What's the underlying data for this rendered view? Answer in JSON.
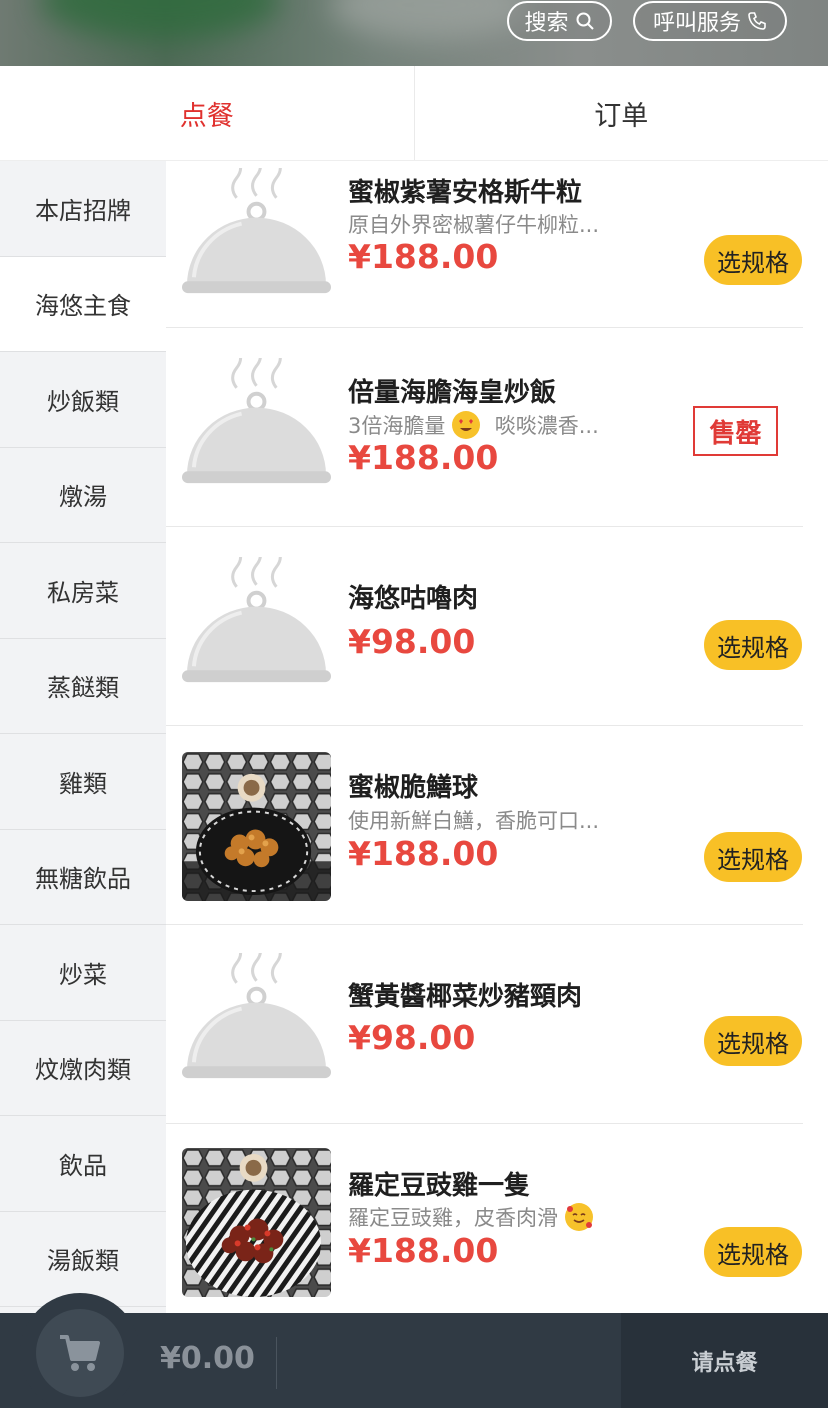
{
  "header": {
    "search_label": "搜索",
    "call_service_label": "呼叫服务"
  },
  "tabs": [
    {
      "label": "点餐",
      "active": true
    },
    {
      "label": "订单",
      "active": false
    }
  ],
  "sidebar": {
    "items": [
      {
        "label": "本店招牌"
      },
      {
        "label": "海悠主食",
        "active": true
      },
      {
        "label": "炒飯類"
      },
      {
        "label": "燉湯"
      },
      {
        "label": "私房菜"
      },
      {
        "label": "蒸餸類"
      },
      {
        "label": "雞類"
      },
      {
        "label": "無糖飲品"
      },
      {
        "label": "炒菜"
      },
      {
        "label": "炆燉肉類"
      },
      {
        "label": "飲品"
      },
      {
        "label": "湯飯類"
      }
    ]
  },
  "menu": {
    "items": [
      {
        "name": "蜜椒紫薯安格斯牛粒",
        "desc": "原自外界密椒薯仔牛柳粒...",
        "price": "¥188.00",
        "action": "选规格",
        "image": "placeholder-cloche-icon"
      },
      {
        "name": "倍量海膽海皇炒飯",
        "desc": "3倍海膽量",
        "desc_emoji": "heart-eyes-emoji",
        "desc_tail": "啖啖濃香...",
        "price": "¥188.00",
        "status": "售罄",
        "image": "placeholder-cloche-icon"
      },
      {
        "name": "海悠咕嚕肉",
        "price": "¥98.00",
        "action": "选规格",
        "image": "placeholder-cloche-icon"
      },
      {
        "name": "蜜椒脆鱔球",
        "desc": "使用新鮮白鱔，香脆可口...",
        "price": "¥188.00",
        "action": "选规格",
        "image": "fried-eel-photo"
      },
      {
        "name": "蟹黃醬椰菜炒豬頸肉",
        "price": "¥98.00",
        "action": "选规格",
        "image": "placeholder-cloche-icon"
      },
      {
        "name": "羅定豆豉雞一隻",
        "desc": "羅定豆豉雞，皮香肉滑",
        "desc_emoji": "smiling-hearts-emoji",
        "price": "¥188.00",
        "action": "选规格",
        "image": "chicken-dish-photo"
      }
    ]
  },
  "cart": {
    "total": "¥0.00",
    "checkout_label": "请点餐"
  },
  "colors": {
    "accent_red": "#e0312e",
    "price_red": "#e8483f",
    "button_yellow": "#f8c026",
    "bottom_bar": "#303a44"
  }
}
